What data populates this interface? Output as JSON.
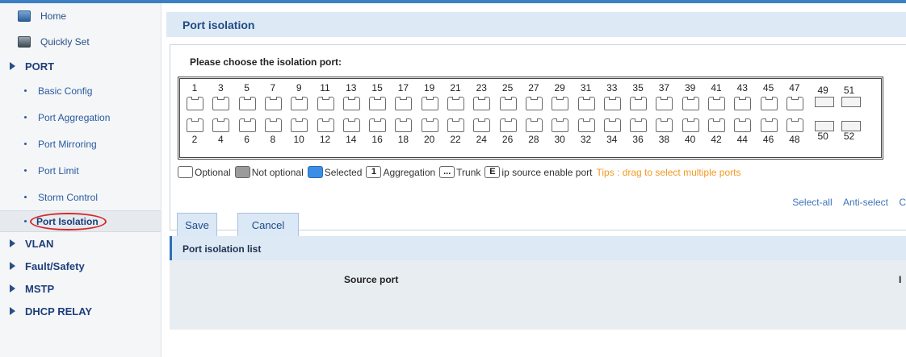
{
  "sidebar": {
    "top_items": [
      {
        "label": "Home",
        "icon": "home-icon"
      },
      {
        "label": "Quickly Set",
        "icon": "quick-set-icon"
      }
    ],
    "port_group": "PORT",
    "port_items": [
      {
        "label": "Basic Config"
      },
      {
        "label": "Port Aggregation"
      },
      {
        "label": "Port Mirroring"
      },
      {
        "label": "Port Limit"
      },
      {
        "label": "Storm Control"
      },
      {
        "label": "Port Isolation",
        "active": true
      }
    ],
    "other_groups": [
      "VLAN",
      "Fault/Safety",
      "MSTP",
      "DHCP RELAY"
    ]
  },
  "main": {
    "title": "Port isolation",
    "instruction": "Please choose the isolation port:",
    "ports_top": [
      "1",
      "3",
      "5",
      "7",
      "9",
      "11",
      "13",
      "15",
      "17",
      "19",
      "21",
      "23",
      "25",
      "27",
      "29",
      "31",
      "33",
      "35",
      "37",
      "39",
      "41",
      "43",
      "45",
      "47",
      "49",
      "51"
    ],
    "ports_bottom": [
      "2",
      "4",
      "6",
      "8",
      "10",
      "12",
      "14",
      "16",
      "18",
      "20",
      "22",
      "24",
      "26",
      "28",
      "30",
      "32",
      "34",
      "36",
      "38",
      "40",
      "42",
      "44",
      "46",
      "48",
      "50",
      "52"
    ],
    "legend": {
      "optional": "Optional",
      "not_optional": "Not optional",
      "selected": "Selected",
      "aggregation_icon": "1",
      "aggregation": "Aggregation",
      "trunk_icon": "...",
      "trunk": "Trunk",
      "ip_source_icon": "E",
      "ip_source": "ip source enable port",
      "tips": "Tips : drag to select multiple ports"
    },
    "select_all": "Select-all",
    "anti_select": "Anti-select",
    "clear_partial": "C",
    "save_label": "Save",
    "cancel_label": "Cancel",
    "list_title": "Port isolation list",
    "col_source": "Source port",
    "col_second_partial": "I"
  },
  "colors": {
    "accent": "#3d7fc3",
    "header_bg": "#dde9f4",
    "tips": "#f39a24",
    "active_circle": "#d42a2a"
  }
}
